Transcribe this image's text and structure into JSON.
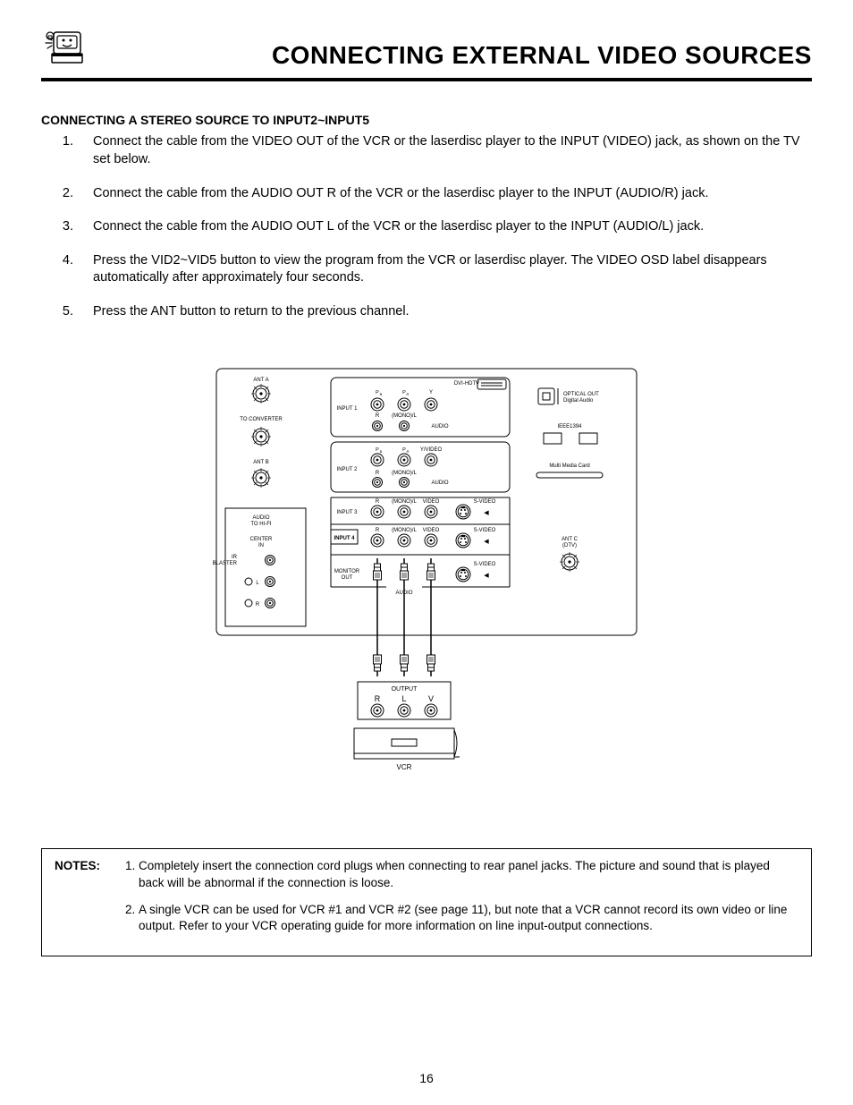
{
  "header": {
    "title": "CONNECTING EXTERNAL VIDEO SOURCES"
  },
  "section": {
    "subtitle": "CONNECTING A STEREO SOURCE TO INPUT2~INPUT5",
    "steps": [
      "Connect the cable from the VIDEO OUT of the VCR or the laserdisc player to the INPUT (VIDEO) jack, as shown on the TV set below.",
      "Connect the cable from the AUDIO OUT R of the VCR or the laserdisc player to the INPUT (AUDIO/R) jack.",
      "Connect the cable from the AUDIO OUT L of the VCR or the laserdisc player to the INPUT (AUDIO/L) jack.",
      "Press the VID2~VID5 button to view the program from the VCR or laserdisc player.  The VIDEO OSD label disappears automatically after approximately four seconds.",
      "Press the ANT button to return to the previous channel."
    ]
  },
  "diagram": {
    "ant_a": "ANT A",
    "to_converter": "TO CONVERTER",
    "ant_b": "ANT B",
    "audio_hifi1": "AUDIO",
    "audio_hifi2": "TO HI-FI",
    "ir_blaster1": "IR",
    "ir_blaster2": "BLASTER",
    "center_in1": "CENTER",
    "center_in2": "IN",
    "L": "L",
    "R": "R",
    "input1": "INPUT 1",
    "input2": "INPUT 2",
    "input3": "INPUT 3",
    "input4": "INPUT 4",
    "monitor_out1": "MONITOR",
    "monitor_out2": "OUT",
    "dvi_hdtv": "DVI-HDTV",
    "pb": "PB",
    "pr": "PR",
    "y": "Y",
    "yvideo": "Y/VIDEO",
    "monoL": "(MONO)/L",
    "video": "VIDEO",
    "svideo": "S-VIDEO",
    "audio": "AUDIO",
    "audio_r_top": "R",
    "arrow": "◀",
    "optical1": "OPTICAL OUT",
    "optical2": "Digital Audio",
    "ieee": "IEEE1394",
    "mmc": "Multi Media Card",
    "antc1": "ANT C",
    "antc2": "(DTV)",
    "output": "OUTPUT",
    "out_r": "R",
    "out_l": "L",
    "out_v": "V",
    "vcr": "VCR"
  },
  "notes": {
    "label": "NOTES:",
    "items": [
      "Completely insert the connection cord plugs when connecting to rear panel jacks.  The picture and sound that is played back will be abnormal if the connection is loose.",
      "A single VCR can be used for VCR #1 and VCR #2 (see page 11), but note that a VCR cannot record its own video or line output.  Refer to your VCR operating guide for more information on line input-output connections."
    ]
  },
  "page_number": "16"
}
